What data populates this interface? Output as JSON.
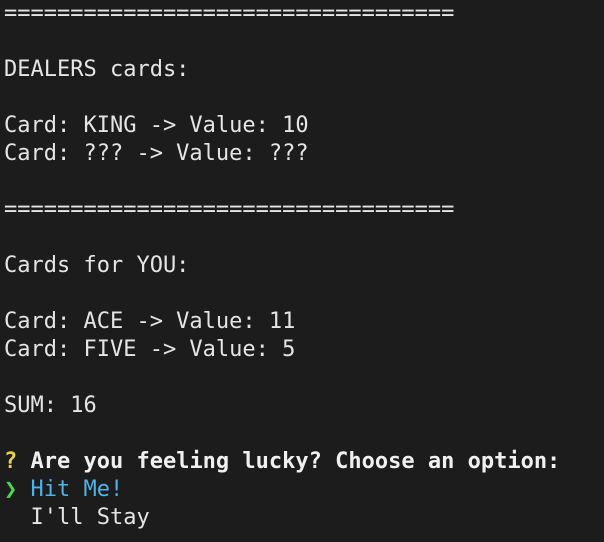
{
  "separator": "==================================",
  "dealer": {
    "heading": "DEALERS cards:",
    "cards": [
      "Card: KING -> Value: 10",
      "Card: ??? -> Value: ???"
    ]
  },
  "player": {
    "heading": "Cards for YOU:",
    "cards": [
      "Card: ACE -> Value: 11",
      "Card: FIVE -> Value: 5"
    ],
    "sum": "SUM: 16"
  },
  "prompt": {
    "marker": "?",
    "question": "Are you feeling lucky? Choose an option:",
    "pointer": "❯",
    "options": [
      "Hit Me!",
      "I'll Stay"
    ]
  },
  "colors": {
    "background": "#1c1c1c",
    "text": "#e5e5e5",
    "question_mark": "#e5d24a",
    "pointer": "#4fd15a",
    "selected_option": "#4fb3e8"
  }
}
